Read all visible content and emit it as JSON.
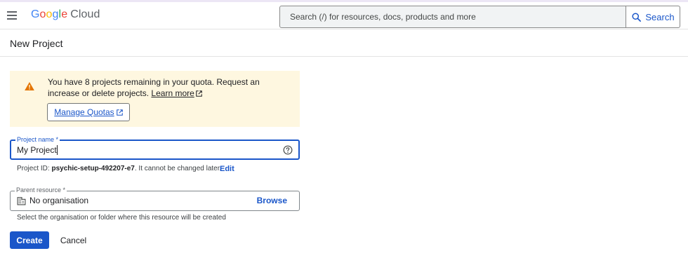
{
  "header": {
    "logo_google": [
      "G",
      "o",
      "o",
      "g",
      "l",
      "e"
    ],
    "logo_cloud": "Cloud",
    "search_placeholder": "Search (/) for resources, docs, products and more",
    "search_button": "Search"
  },
  "page": {
    "title": "New Project"
  },
  "quota_notice": {
    "message": "You have 8 projects remaining in your quota. Request an increase or delete projects.",
    "learn_more": "Learn more",
    "manage_quotas": "Manage Quotas"
  },
  "project_name": {
    "label": "Project name *",
    "value": "My Project",
    "project_id_prefix": "Project ID:",
    "project_id": "psychic-setup-492207-e7",
    "project_id_suffix": ". It cannot be changed later.",
    "edit": "Edit"
  },
  "parent_resource": {
    "label": "Parent resource *",
    "value": "No organisation",
    "browse": "Browse",
    "hint": "Select the organisation or folder where this resource will be created"
  },
  "actions": {
    "create": "Create",
    "cancel": "Cancel"
  },
  "colors": {
    "accent": "#1a56c9",
    "warning_bg": "#fef7e0",
    "warning_icon": "#e37400"
  },
  "icons": {
    "menu": "hamburger-menu-icon",
    "search": "search-icon",
    "warning": "warning-icon",
    "external": "external-link-icon",
    "help": "help-circle-icon",
    "organisation": "building-icon"
  }
}
